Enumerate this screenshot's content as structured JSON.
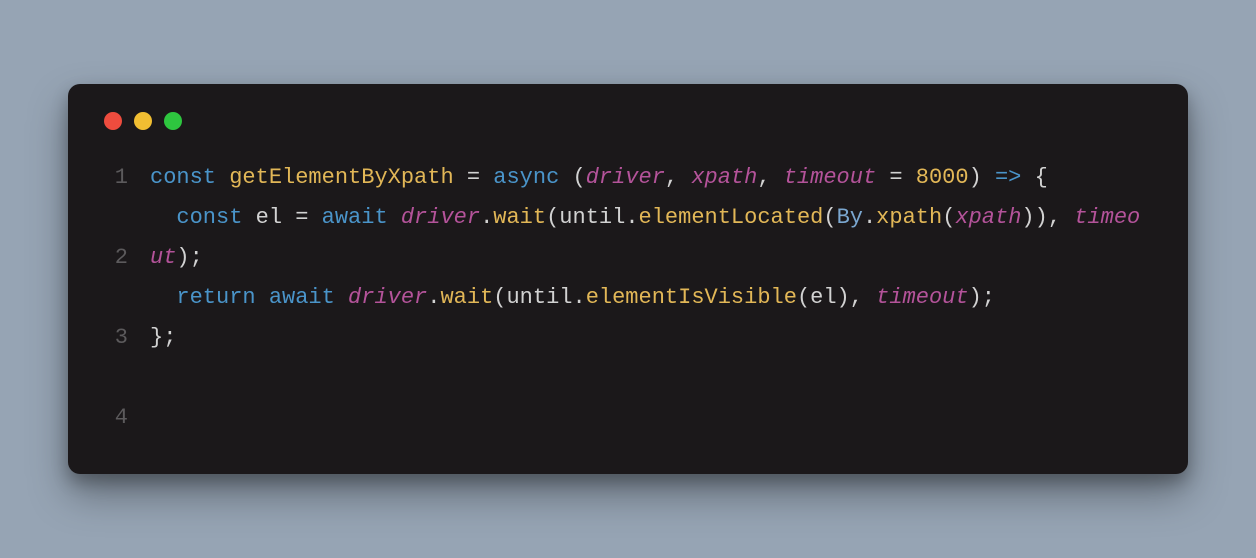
{
  "code": {
    "lines": [
      "1",
      "2",
      "3",
      "4"
    ],
    "tokens": {
      "l1": {
        "const": "const",
        "fname": "getElementByXpath",
        "eq": " = ",
        "async": "async",
        "open": " (",
        "p1": "driver",
        "c1": ", ",
        "p2": "xpath",
        "c2": ", ",
        "p3": "timeout",
        "eq2": " = ",
        "num": "8000",
        "close": ") ",
        "arrow": "=>",
        "brace": " {"
      },
      "l2": {
        "indent": "  ",
        "const": "const",
        "sp1": " ",
        "el": "el",
        "eq": " = ",
        "await": "await",
        "sp2": " ",
        "driver": "driver",
        "dot1": ".",
        "wait": "wait",
        "open1": "(",
        "until": "until",
        "dot2": ".",
        "elemLoc": "elementLocated",
        "open2": "(",
        "by": "By",
        "dot3": ".",
        "xpath": "xpath",
        "open3": "(",
        "xp": "xpath",
        "close3": "))",
        "c1": ", ",
        "timeout": "timeout",
        "close1": ");"
      },
      "l3": {
        "indent": "  ",
        "return": "return",
        "sp1": " ",
        "await": "await",
        "sp2": " ",
        "driver": "driver",
        "dot1": ".",
        "wait": "wait",
        "open1": "(",
        "until": "until",
        "dot2": ".",
        "elemVis": "elementIsVisible",
        "open2": "(",
        "el": "el",
        "close2": ")",
        "c1": ", ",
        "timeout": "timeout",
        "close1": ");"
      },
      "l4": {
        "brace": "};"
      }
    }
  }
}
